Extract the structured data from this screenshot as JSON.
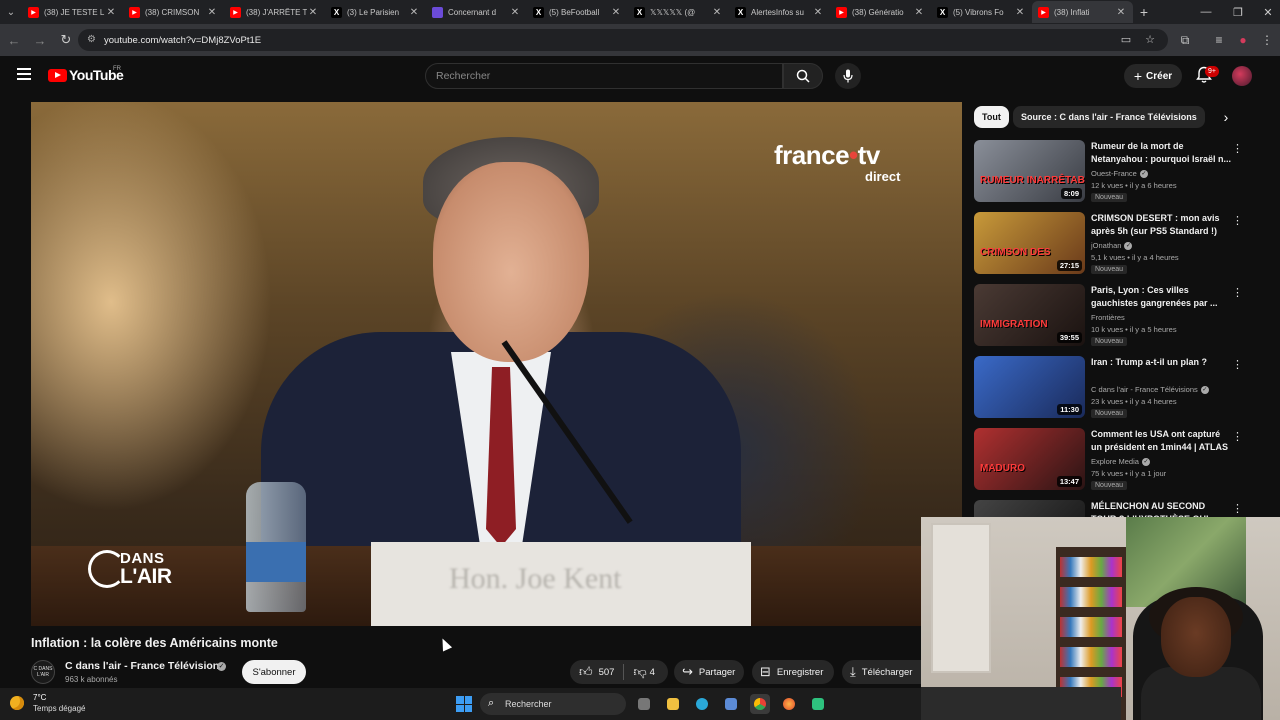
{
  "browser": {
    "tabs": [
      {
        "title": "(38) JE TESTE L",
        "icon": "youtube-icon",
        "color": "#ff0000"
      },
      {
        "title": "(38) CRIMSON",
        "icon": "youtube-icon",
        "color": "#ff0000"
      },
      {
        "title": "(38) J'ARRÊTE T",
        "icon": "youtube-icon",
        "color": "#ff0000"
      },
      {
        "title": "(3) Le Parisien",
        "icon": "x-icon",
        "color": "#000000"
      },
      {
        "title": "Concernant d",
        "icon": "page-icon",
        "color": "#6b4bd8"
      },
      {
        "title": "(5) BeFootball",
        "icon": "x-icon",
        "color": "#000000"
      },
      {
        "title": "𝕏𝕏𝕏𝕏𝕏 (@",
        "icon": "x-icon",
        "color": "#000000"
      },
      {
        "title": "AlertesInfos su",
        "icon": "x-icon",
        "color": "#000000"
      },
      {
        "title": "(38) Génératio",
        "icon": "youtube-icon",
        "color": "#ff0000"
      },
      {
        "title": "(5) Vibrons Fo",
        "icon": "x-icon",
        "color": "#000000"
      },
      {
        "title": "(38) Inflati",
        "icon": "youtube-icon",
        "color": "#ff0000",
        "active": true
      }
    ],
    "url": "youtube.com/watch?v=DMj8ZVoPt1E"
  },
  "header": {
    "logo_text": "YouTube",
    "country_code": "FR",
    "search_placeholder": "Rechercher",
    "create_label": "Créer",
    "notifications_badge": "9+"
  },
  "video": {
    "broadcaster": "france",
    "broadcaster_tv": "tv",
    "broadcaster_sub": "direct",
    "show_logo_line1": "DANS",
    "show_logo_line2": "L'AIR",
    "nameplate": "Hon. Joe Kent",
    "title": "Inflation : la colère des Américains monte",
    "channel_avatar_text": "C DANS L'AIR",
    "channel": "C dans l'air - France Télévisions",
    "subscribers": "963 k abonnés",
    "subscribe_label": "S'abonner",
    "likes": "507",
    "dislikes": "4",
    "share_label": "Partager",
    "save_label": "Enregistrer",
    "download_label": "Télécharger"
  },
  "chips": {
    "all": "Tout",
    "source": "Source : C dans l'air - France Télévisions"
  },
  "recommendations": [
    {
      "title": "Rumeur de la mort de Netanyahou : pourquoi Israël n...",
      "channel": "Ouest-France",
      "verified": true,
      "meta": "12 k vues • il y a 6 heures",
      "badge": "Nouveau",
      "duration": "8:09",
      "thumb_text": "RUMEUR INARRÊTABLE",
      "thumb_bg": "linear-gradient(135deg,#8a8f99,#3a3d44)"
    },
    {
      "title": "CRIMSON DESERT : mon avis après 5h (sur PS5 Standard !)",
      "channel": "jOnathan",
      "verified": true,
      "meta": "5,1 k vues • il y a 4 heures",
      "badge": "Nouveau",
      "duration": "27:15",
      "thumb_text": "CRIMSON DES",
      "thumb_bg": "linear-gradient(135deg,#c89a3a,#6a3a1a)"
    },
    {
      "title": "Paris, Lyon : Ces villes gauchistes gangrenées par ...",
      "channel": "Frontières",
      "verified": false,
      "meta": "10 k vues • il y a 5 heures",
      "badge": "Nouveau",
      "duration": "39:55",
      "thumb_text": "IMMIGRATION",
      "thumb_bg": "linear-gradient(135deg,#4a3a34,#1a1210)"
    },
    {
      "title": "Iran : Trump a-t-il un plan ?",
      "channel": "C dans l'air - France Télévisions",
      "verified": true,
      "meta": "23 k vues • il y a 4 heures",
      "badge": "Nouveau",
      "duration": "11:30",
      "thumb_text": "",
      "thumb_bg": "linear-gradient(135deg,#3a6ac8,#1a2a5a)"
    },
    {
      "title": "Comment les USA ont capturé un président en 1min44 | ATLAS",
      "channel": "Explore Media",
      "verified": true,
      "meta": "75 k vues • il y a 1 jour",
      "badge": "Nouveau",
      "duration": "13:47",
      "thumb_text": "MADURO",
      "thumb_bg": "linear-gradient(135deg,#b03030,#2a1414)"
    },
    {
      "title": "MÉLENCHON AU SECOND TOUR ? L'HYPOTHÈSE QUI...",
      "channel": "",
      "verified": false,
      "meta": "",
      "badge": "",
      "duration": "",
      "thumb_text": "",
      "thumb_bg": "linear-gradient(135deg,#444,#111)"
    }
  ],
  "taskbar": {
    "temperature": "7°C",
    "weather": "Temps dégagé",
    "search_label": "Rechercher"
  }
}
